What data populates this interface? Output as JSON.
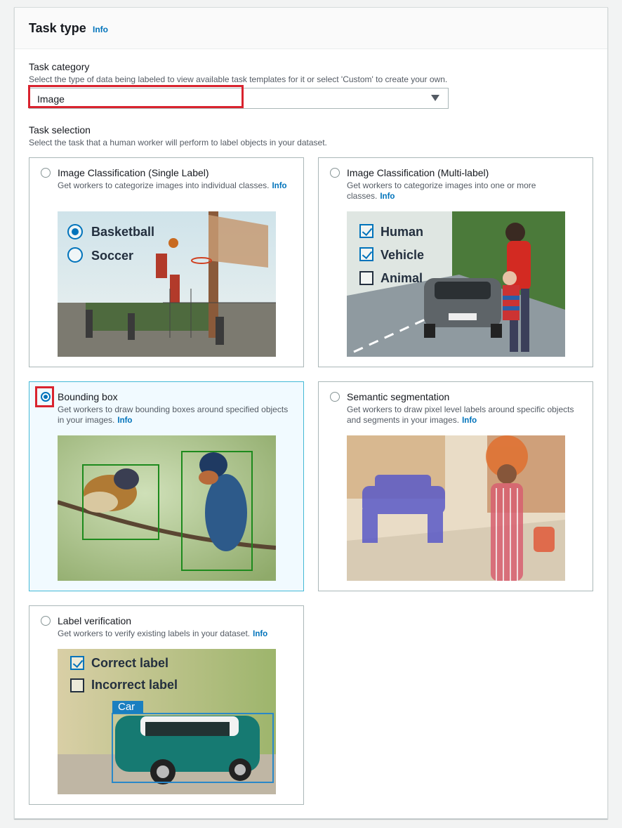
{
  "header": {
    "title": "Task type",
    "info": "Info"
  },
  "task_category": {
    "label": "Task category",
    "description": "Select the type of data being labeled to view available task templates for it or select 'Custom' to create your own.",
    "value": "Image"
  },
  "task_selection": {
    "label": "Task selection",
    "description": "Select the task that a human worker will perform to label objects in your dataset."
  },
  "cards": [
    {
      "title": "Image Classification (Single Label)",
      "description": "Get workers to categorize images into individual classes.",
      "info": "Info",
      "selected": false,
      "overlay": [
        "Basketball",
        "Soccer"
      ]
    },
    {
      "title": "Image Classification (Multi-label)",
      "description": "Get workers to categorize images into one or more classes.",
      "info": "Info",
      "selected": false,
      "overlay": [
        "Human",
        "Vehicle",
        "Animal"
      ]
    },
    {
      "title": "Bounding box",
      "description": "Get workers to draw bounding boxes around specified objects in your images.",
      "info": "Info",
      "selected": true
    },
    {
      "title": "Semantic segmentation",
      "description": "Get workers to draw pixel level labels around specific objects and segments in your images.",
      "info": "Info",
      "selected": false
    },
    {
      "title": "Label verification",
      "description": "Get workers to verify existing labels in your dataset.",
      "info": "Info",
      "selected": false,
      "overlay": [
        "Correct label",
        "Incorrect label",
        "Car"
      ]
    }
  ],
  "colors": {
    "accent": "#0073bb",
    "highlight": "#d9232e",
    "selected_bg": "#f1faff"
  }
}
